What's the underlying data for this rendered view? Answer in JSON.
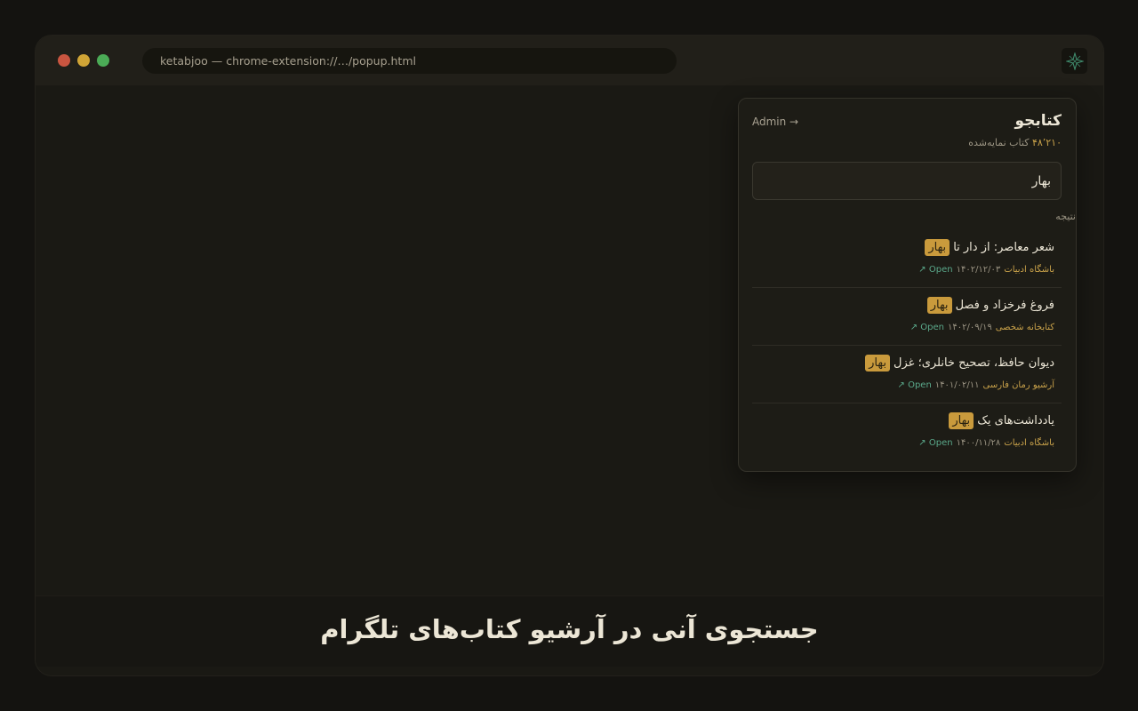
{
  "window": {
    "url": "ketabjoo — chrome-extension://…/popup.html",
    "traffic_lights": [
      "close",
      "minimize",
      "maximize"
    ],
    "extension_icon": "compass-star-icon"
  },
  "popup": {
    "title": "کتابجو",
    "admin_link": "Admin →",
    "book_count_number": "۴۸٬۲۱۰",
    "book_count_suffix": "کتاب نمایه‌شده",
    "search": {
      "value": "بهار",
      "placeholder": ""
    },
    "result_label": "نتیجه",
    "results": [
      {
        "title_prefix": "شعر معاصر: از دار تا",
        "highlight": "بهار",
        "source": "باشگاه ادبیات",
        "date": "۱۴۰۲/۱۲/۰۳",
        "open": "Open ↗"
      },
      {
        "title_prefix": "فروغ فرخزاد و فصل",
        "highlight": "بهار",
        "source": "کتابخانه شخصی",
        "date": "۱۴۰۲/۰۹/۱۹",
        "open": "Open ↗"
      },
      {
        "title_prefix": "دیوان حافظ، تصحیح خانلری؛ غزل",
        "highlight": "بهار",
        "source": "آرشیو رمان فارسی",
        "date": "۱۴۰۱/۰۲/۱۱",
        "open": "Open ↗"
      },
      {
        "title_prefix": "یادداشت‌های یک",
        "highlight": "بهار",
        "source": "باشگاه ادبیات",
        "date": "۱۴۰۰/۱۱/۲۸",
        "open": "Open ↗"
      }
    ]
  },
  "caption": "جستجوی آنی در آرشیو کتاب‌های تلگرام",
  "colors": {
    "accent": "#c99a3c",
    "link": "#5aa88a",
    "background": "#141310"
  }
}
